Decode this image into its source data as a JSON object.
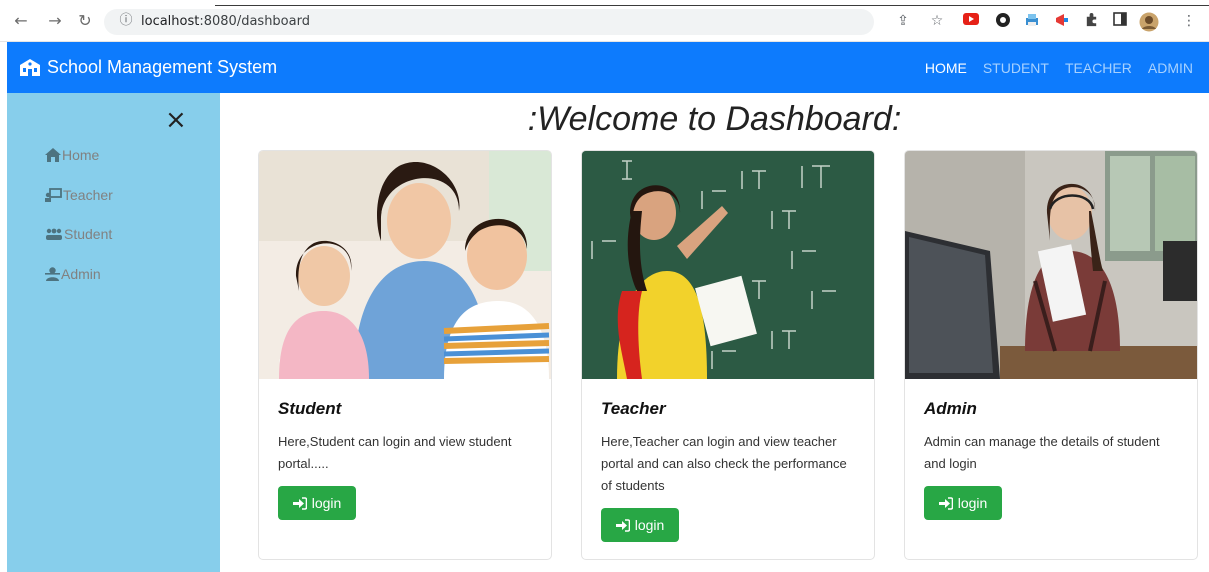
{
  "browser": {
    "url_host": "localhost",
    "url_rest": ":8080/dashboard"
  },
  "navbar": {
    "brand": "School Management System",
    "links": [
      {
        "label": "HOME",
        "active": true
      },
      {
        "label": "STUDENT",
        "active": false
      },
      {
        "label": "TEACHER",
        "active": false
      },
      {
        "label": "ADMIN",
        "active": false
      }
    ]
  },
  "sidebar": {
    "close_glyph": "×",
    "items": [
      {
        "label": "Home",
        "icon": "home-icon"
      },
      {
        "label": "Teacher",
        "icon": "chalkboard-teacher-icon"
      },
      {
        "label": "Student",
        "icon": "users-icon"
      },
      {
        "label": "Admin",
        "icon": "user-tie-icon"
      }
    ]
  },
  "main": {
    "heading": ":Welcome to Dashboard:",
    "cards": [
      {
        "title": "Student",
        "text": "Here,Student can login and view student portal.....",
        "button": "login"
      },
      {
        "title": "Teacher",
        "text": "Here,Teacher can login and view teacher portal and can also check the performance of students",
        "button": "login"
      },
      {
        "title": "Admin",
        "text": "Admin can manage the details of student and login",
        "button": "login"
      }
    ]
  },
  "colors": {
    "navbar": "#0d7bfd",
    "sidebar": "#87ceeb",
    "button": "#28a745"
  }
}
